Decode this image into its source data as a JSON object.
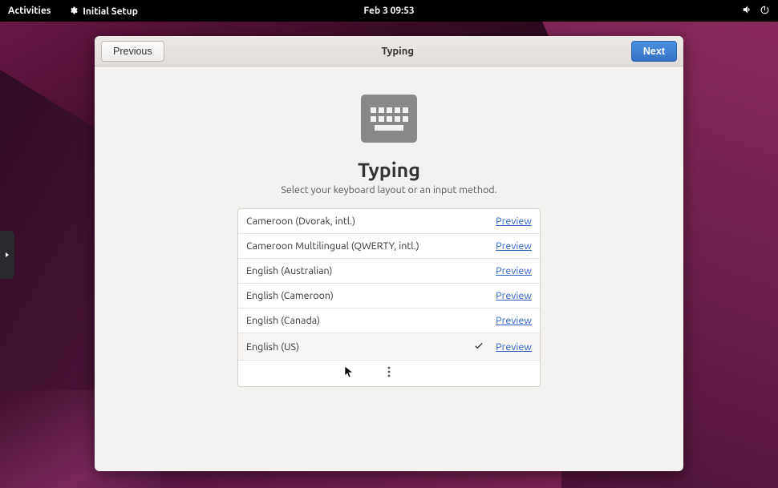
{
  "topbar": {
    "activities": "Activities",
    "app": "Initial Setup",
    "datetime": "Feb 3  09:53"
  },
  "header": {
    "prev": "Previous",
    "title": "Typing",
    "next": "Next"
  },
  "page": {
    "title": "Typing",
    "subtitle": "Select your keyboard layout or an input method."
  },
  "list": {
    "preview_label": "Preview",
    "items": [
      {
        "name": "Cameroon (Dvorak, intl.)",
        "selected": false
      },
      {
        "name": "Cameroon Multilingual (QWERTY, intl.)",
        "selected": false
      },
      {
        "name": "English (Australian)",
        "selected": false
      },
      {
        "name": "English (Cameroon)",
        "selected": false
      },
      {
        "name": "English (Canada)",
        "selected": false
      },
      {
        "name": "English (US)",
        "selected": true
      }
    ]
  }
}
